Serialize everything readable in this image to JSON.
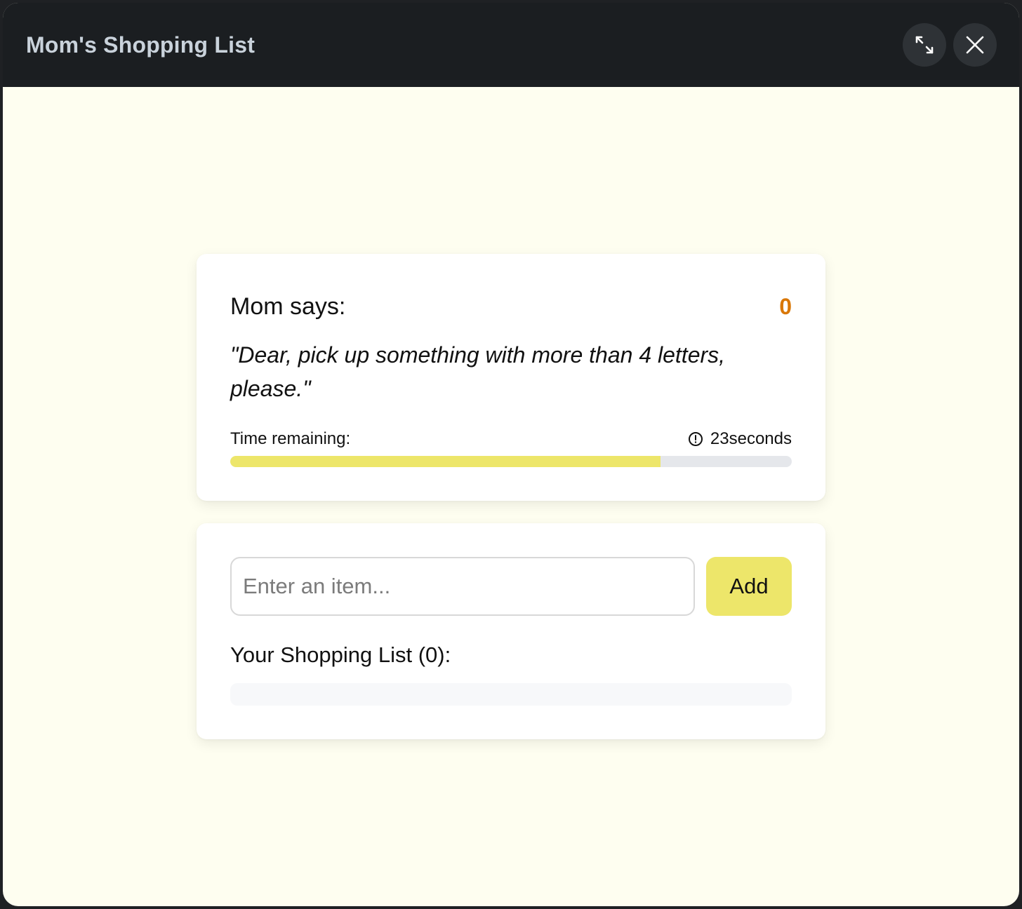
{
  "window": {
    "title": "Mom's Shopping List",
    "expand_icon": "expand-arrows-icon",
    "close_icon": "close-icon"
  },
  "mom": {
    "label": "Mom says:",
    "score": "0",
    "quote": "\"Dear, pick up something with more than 4 letters, please.\"",
    "time_label": "Time remaining:",
    "time_icon": "clock-alert-icon",
    "time_value": "23seconds",
    "progress_fraction": 0.766
  },
  "shopping": {
    "input_value": "",
    "input_placeholder": "Enter an item...",
    "add_label": "Add",
    "list_heading": "Your Shopping List (0):",
    "items": []
  },
  "colors": {
    "accent": "#ede66a",
    "score": "#d97706",
    "titlebar": "#1b1e21",
    "background": "#fefef0"
  }
}
